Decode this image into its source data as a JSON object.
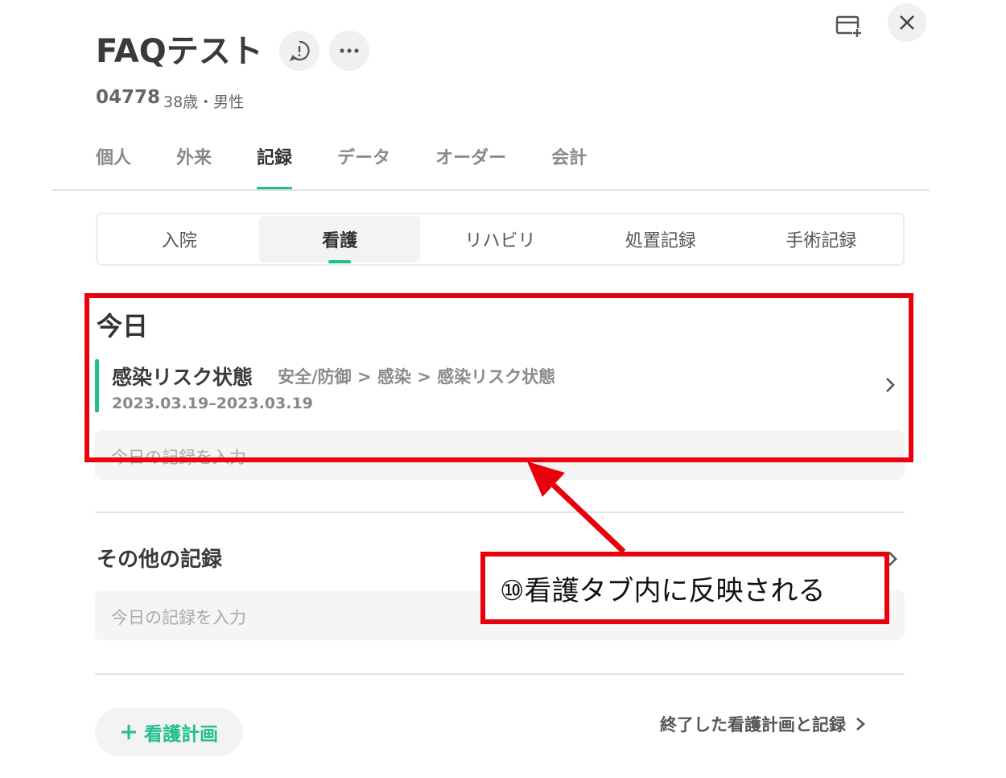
{
  "header": {
    "title": "FAQテスト",
    "patient_id": "04778",
    "patient_meta": "38歳・男性"
  },
  "main_tabs": [
    {
      "label": "個人",
      "active": false
    },
    {
      "label": "外来",
      "active": false
    },
    {
      "label": "記録",
      "active": true
    },
    {
      "label": "データ",
      "active": false
    },
    {
      "label": "オーダー",
      "active": false
    },
    {
      "label": "会計",
      "active": false
    }
  ],
  "sub_tabs": [
    {
      "label": "入院",
      "active": false
    },
    {
      "label": "看護",
      "active": true
    },
    {
      "label": "リハビリ",
      "active": false
    },
    {
      "label": "処置記録",
      "active": false
    },
    {
      "label": "手術記録",
      "active": false
    }
  ],
  "today": {
    "title": "今日",
    "record": {
      "name": "感染リスク状態",
      "path": "安全/防御 > 感染 > 感染リスク状態",
      "date_range": "2023.03.19–2023.03.19"
    },
    "input_placeholder": "今日の記録を入力"
  },
  "other": {
    "title": "その他の記録",
    "input_placeholder": "今日の記録を入力"
  },
  "footer": {
    "plan_button_label": "看護計画",
    "ended_link_label": "終了した看護計画と記録"
  },
  "annotation": {
    "callout_text": "⑩看護タブ内に反映される"
  },
  "colors": {
    "accent": "#1fbf8f",
    "annotation_red": "#e8000b",
    "text_dark": "#333333",
    "text_muted": "#8a8a8a"
  },
  "icons": [
    "info-bubble-icon",
    "more-icon",
    "card-add-icon",
    "close-icon",
    "chevron-right-icon",
    "plus-icon",
    "arrow-icon"
  ]
}
